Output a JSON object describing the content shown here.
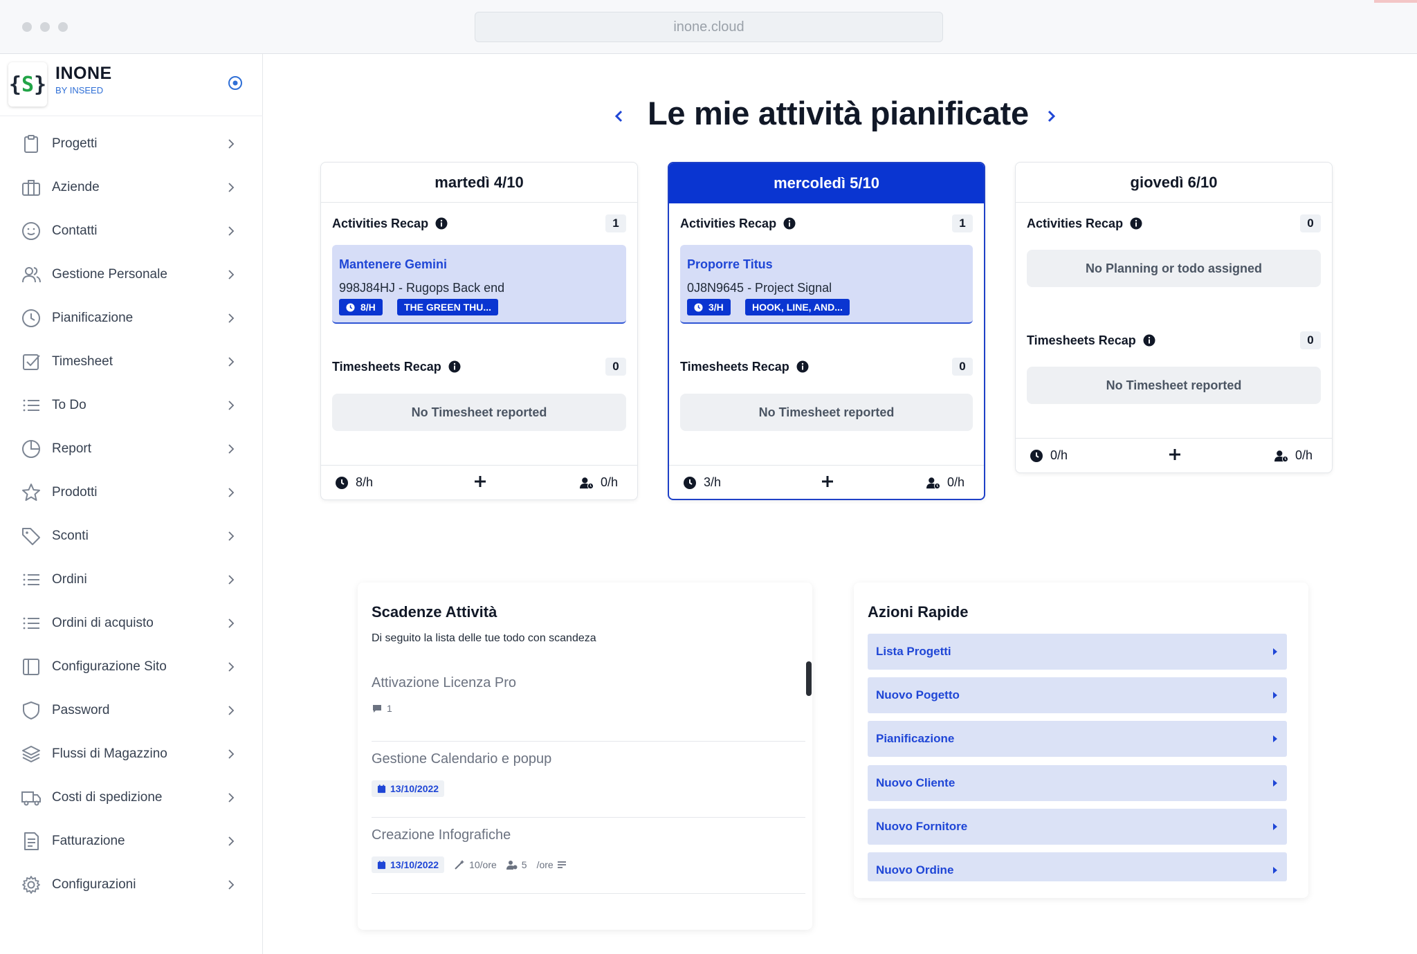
{
  "browser": {
    "url": "inone.cloud"
  },
  "brand": {
    "name": "INONE",
    "sub": "BY INSEED",
    "logo_glyph_left": "{",
    "logo_glyph_mid": "S",
    "logo_glyph_right": "}"
  },
  "sidebar": {
    "items": [
      {
        "label": "Progetti",
        "icon": "clipboard-icon"
      },
      {
        "label": "Aziende",
        "icon": "briefcase-icon"
      },
      {
        "label": "Contatti",
        "icon": "smile-icon"
      },
      {
        "label": "Gestione Personale",
        "icon": "users-icon"
      },
      {
        "label": "Pianificazione",
        "icon": "clock-icon"
      },
      {
        "label": "Timesheet",
        "icon": "checkbox-icon"
      },
      {
        "label": "To Do",
        "icon": "list-icon"
      },
      {
        "label": "Report",
        "icon": "pie-chart-icon"
      },
      {
        "label": "Prodotti",
        "icon": "star-icon"
      },
      {
        "label": "Sconti",
        "icon": "tag-icon"
      },
      {
        "label": "Ordini",
        "icon": "list-icon"
      },
      {
        "label": "Ordini di acquisto",
        "icon": "list-icon"
      },
      {
        "label": "Configurazione Sito",
        "icon": "layout-icon"
      },
      {
        "label": "Password",
        "icon": "shield-icon"
      },
      {
        "label": "Flussi di Magazzino",
        "icon": "layers-icon"
      },
      {
        "label": "Costi di spedizione",
        "icon": "truck-icon"
      },
      {
        "label": "Fatturazione",
        "icon": "invoice-icon"
      },
      {
        "label": "Configurazioni",
        "icon": "gear-icon"
      }
    ]
  },
  "main": {
    "title": "Le mie attività pianificate",
    "days": [
      {
        "label": "martedì 4/10",
        "activities_label": "Activities Recap",
        "activities_count": "1",
        "activity": {
          "title": "Mantenere Gemini",
          "subtitle": "998J84HJ - Rugops Back end",
          "hours": "8/H",
          "tag": "THE GREEN THU..."
        },
        "timesheets_label": "Timesheets Recap",
        "timesheets_count": "0",
        "timesheets_empty": "No Timesheet reported",
        "foot_hours": "8/h",
        "foot_people": "0/h"
      },
      {
        "label": "mercoledì 5/10",
        "activities_label": "Activities Recap",
        "activities_count": "1",
        "activity": {
          "title": "Proporre Titus",
          "subtitle": "0J8N9645 - Project Signal",
          "hours": "3/H",
          "tag": "HOOK, LINE, AND..."
        },
        "timesheets_label": "Timesheets Recap",
        "timesheets_count": "0",
        "timesheets_empty": "No Timesheet reported",
        "foot_hours": "3/h",
        "foot_people": "0/h"
      },
      {
        "label": "giovedì 6/10",
        "activities_label": "Activities Recap",
        "activities_count": "0",
        "activities_empty": "No Planning or todo assigned",
        "timesheets_label": "Timesheets Recap",
        "timesheets_count": "0",
        "timesheets_empty": "No Timesheet reported",
        "foot_hours": "0/h",
        "foot_people": "0/h"
      }
    ]
  },
  "deadlines": {
    "title": "Scadenze Attività",
    "subtitle": "Di seguito la lista delle tue todo con scandeza",
    "items": [
      {
        "title": "Attivazione Licenza Pro",
        "comments": "1"
      },
      {
        "title": "Gestione Calendario e popup",
        "date": "13/10/2022"
      },
      {
        "title": "Creazione Infografiche",
        "date": "13/10/2022",
        "hours": "10/ore",
        "people": "5",
        "extra": "/ore"
      }
    ]
  },
  "quick_actions": {
    "title": "Azioni Rapide",
    "items": [
      "Lista Progetti",
      "Nuovo Pogetto",
      "Pianificazione",
      "Nuovo Cliente",
      "Nuovo Fornitore",
      "Nuovo Ordine"
    ]
  },
  "colors": {
    "accent": "#0a35d1",
    "link": "#1f46d6",
    "chip_bg": "#d6ddf7",
    "quick_bg": "#dbe2f6"
  }
}
